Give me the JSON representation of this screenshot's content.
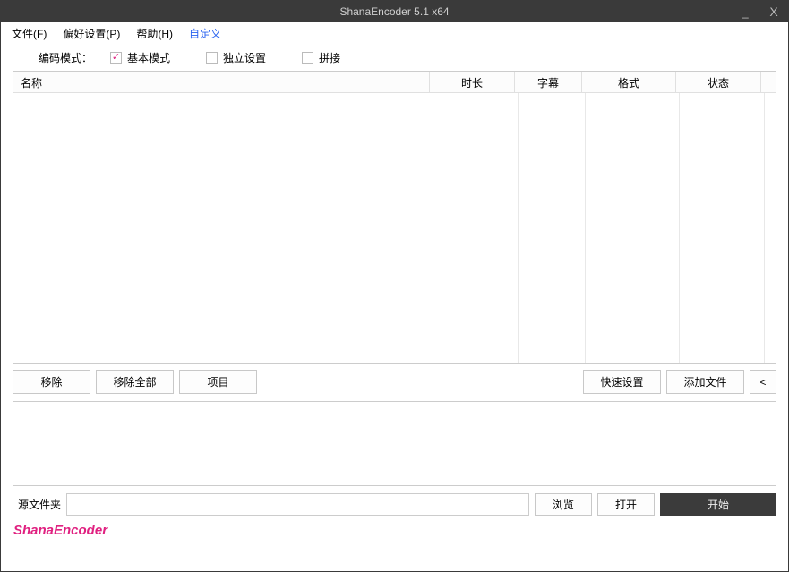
{
  "window": {
    "title": "ShanaEncoder 5.1 x64"
  },
  "menu": {
    "file": "文件(F)",
    "pref": "偏好设置(P)",
    "help": "帮助(H)",
    "custom": "自定义"
  },
  "mode": {
    "label": "编码模式：",
    "basic": "基本模式",
    "independent": "独立设置",
    "concat": "拼接"
  },
  "columns": {
    "name": "名称",
    "duration": "时长",
    "subtitle": "字幕",
    "format": "格式",
    "status": "状态"
  },
  "buttons": {
    "remove": "移除",
    "remove_all": "移除全部",
    "project": "项目",
    "quick_setup": "快速设置",
    "add_file": "添加文件",
    "toggle": "<",
    "browse": "浏览",
    "open": "打开",
    "start": "开始"
  },
  "output": {
    "source_folder": "源文件夹",
    "path": ""
  },
  "footer": "ShanaEncoder"
}
